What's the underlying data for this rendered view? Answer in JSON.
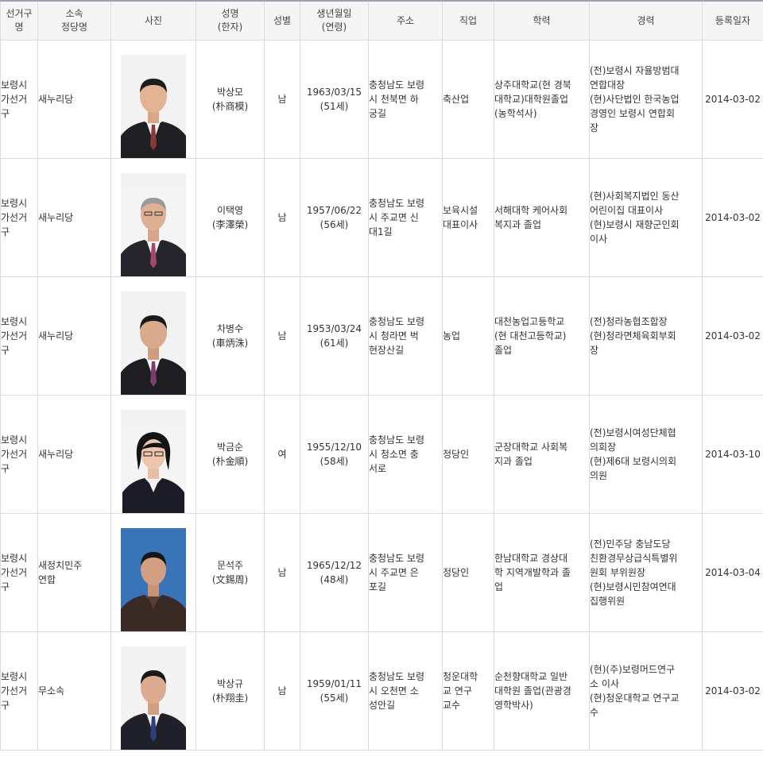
{
  "headers": {
    "district": "선거구\n명",
    "party": "소속\n정당명",
    "photo": "사진",
    "name": "성명\n(한자)",
    "gender": "성별",
    "birth": "생년월일\n(연령)",
    "address": "주소",
    "job": "직업",
    "education": "학력",
    "career": "경력",
    "registered": "등록일자"
  },
  "rows": [
    {
      "district": "보령시\n가선거\n구",
      "party": "새누리당",
      "name": "박상모\n(朴商模)",
      "gender": "남",
      "birth": "1963/03/15\n(51세)",
      "address": "충청남도 보령\n시 천북면 하\n궁길",
      "job": "축산업",
      "education": "상주대학교(현 경북\n대학교)대학원졸업\n(농학석사)",
      "career": "(전)보령시 자율방범대\n연합대장\n(현)사단법인 한국농업\n경영인 보령시 연합회\n장",
      "registered": "2014-03-02"
    },
    {
      "district": "보령시\n가선거\n구",
      "party": "새누리당",
      "name": "이택영\n(李澤榮)",
      "gender": "남",
      "birth": "1957/06/22\n(56세)",
      "address": "충청남도 보령\n시 주교면 신\n대1길",
      "job": "보육시설\n대표이사",
      "education": "서해대학 케어사회\n복지과 졸업",
      "career": "(현)사회복지법인 동산\n어린이집 대표이사\n(현)보령시 재향군인회\n이사",
      "registered": "2014-03-02"
    },
    {
      "district": "보령시\n가선거\n구",
      "party": "새누리당",
      "name": "차병수\n(車炳洙)",
      "gender": "남",
      "birth": "1953/03/24\n(61세)",
      "address": "충청남도 보령\n시 청라면 벅\n현장산길",
      "job": "농업",
      "education": "대천농업고등학교\n(현 대천고등학교)\n졸업",
      "career": "(전)청라농협조합장\n(현)청라면체육회부회\n장",
      "registered": "2014-03-02"
    },
    {
      "district": "보령시\n가선거\n구",
      "party": "새누리당",
      "name": "박금순\n(朴金順)",
      "gender": "여",
      "birth": "1955/12/10\n(58세)",
      "address": "충청남도 보령\n시 청소면 충\n서로",
      "job": "정당인",
      "education": "군장대학교 사회복\n지과 졸업",
      "career": "(전)보령시여성단체협\n의회장\n(현)제6대 보령시의회\n의원",
      "registered": "2014-03-10"
    },
    {
      "district": "보령시\n가선거\n구",
      "party": "새정치민주\n연합",
      "name": "문석주\n(文錫周)",
      "gender": "남",
      "birth": "1965/12/12\n(48세)",
      "address": "충청남도 보령\n시 주교면 은\n포길",
      "job": "정당인",
      "education": "한남대학교 경상대\n학 지역개발학과 졸\n업",
      "career": "(전)민주당 충남도당\n친환경무상급식특별위\n원회 부위원장\n(현)보령시민참여연대\n집행위원",
      "registered": "2014-03-04"
    },
    {
      "district": "보령시\n가선거\n구",
      "party": "무소속",
      "name": "박상규\n(朴翔圭)",
      "gender": "남",
      "birth": "1959/01/11\n(55세)",
      "address": "충청남도 보령\n시 오천면 소\n성안길",
      "job": "청운대학\n교 연구\n교수",
      "education": "순천향대학교 일반\n대학원 졸업(관광경\n영학박사)",
      "career": "(현)(주)보령머드연구\n소 이사\n(현)청운대학교 연구교\n수",
      "registered": "2014-03-02"
    }
  ]
}
